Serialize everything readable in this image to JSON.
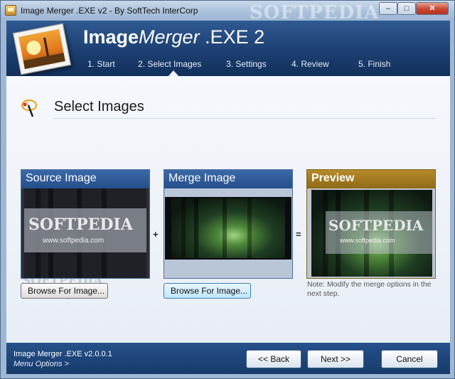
{
  "window": {
    "title": "Image Merger .EXE v2 - By SoftTech InterCorp",
    "watermark": "SOFTPEDIA",
    "controls": {
      "minimize": "–",
      "maximize": "□",
      "close": "✕"
    }
  },
  "header": {
    "app_name_bold": "Image",
    "app_name_italic": "Merger",
    "app_name_suffix": " .EXE 2",
    "steps": [
      "1. Start",
      "2. Select Images",
      "3. Settings",
      "4. Review",
      "5. Finish"
    ],
    "active_step": "2. Select Images"
  },
  "section": {
    "title": "Select Images",
    "icon": "magic-wand-icon"
  },
  "panels": {
    "source": {
      "title": "Source Image",
      "watermark": "SOFTPEDIA",
      "url_text": "www.softpedia.com"
    },
    "merge": {
      "title": "Merge Image"
    },
    "preview": {
      "title": "Preview",
      "watermark": "SOFTPEDIA",
      "url_text": "www.softpedia.com"
    }
  },
  "operators": {
    "plus": "+",
    "equals": "="
  },
  "browse_source_label": "Browse For Image...",
  "browse_merge_label": "Browse For Image...",
  "note": "Note: Modify the merge options in the next step.",
  "background_watermark": {
    "main": "SOFTPEDIA",
    "sub": "www.softpedia.com"
  },
  "footer": {
    "version": "Image Merger .EXE v2.0.0.1",
    "menu_options": "Menu Options >",
    "back_label": "<< Back",
    "next_label": "Next >>",
    "cancel_label": "Cancel"
  },
  "colors": {
    "banner": "#1d3f72",
    "panel_header_blue": "#2d5a96",
    "panel_header_gold": "#a07a20",
    "footer": "#1f4679"
  }
}
